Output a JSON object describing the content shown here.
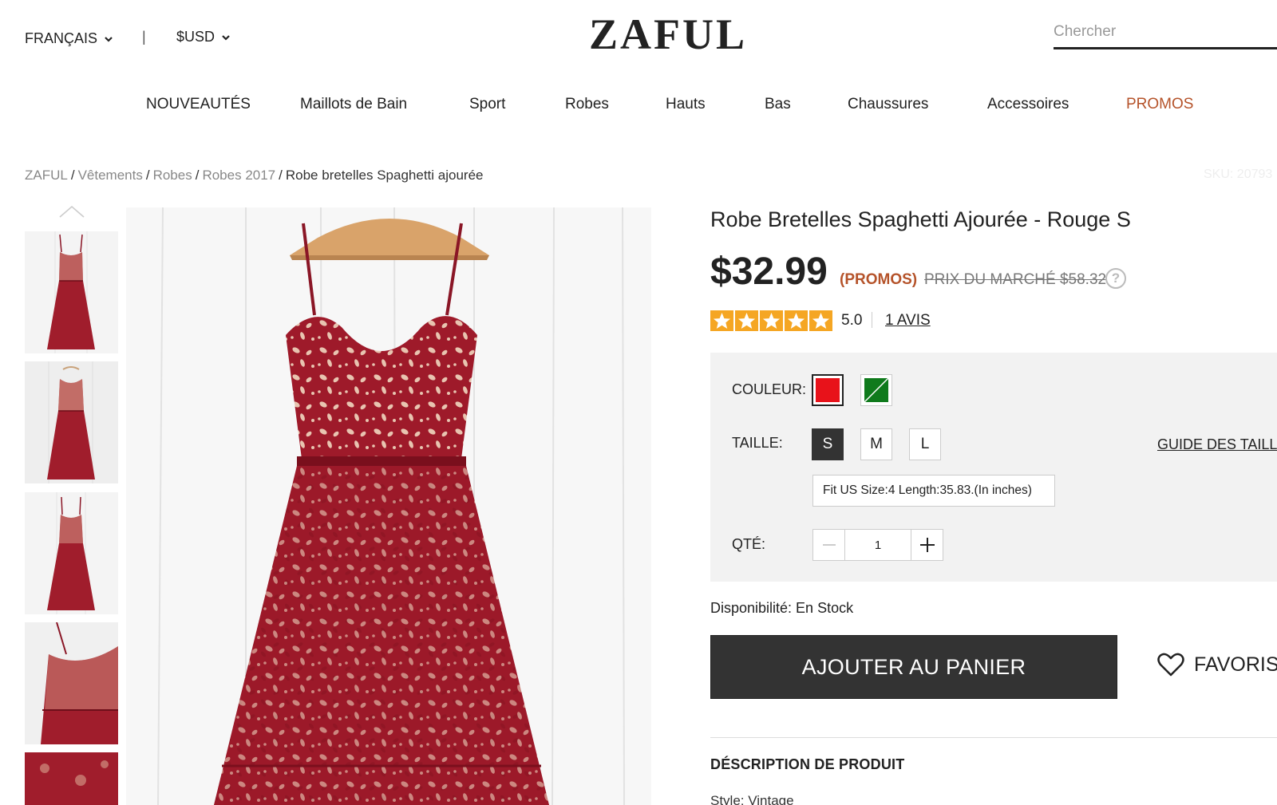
{
  "header": {
    "language": "FRANÇAIS",
    "separator": "|",
    "currency": "$USD",
    "logo": "ZAFUL",
    "search_placeholder": "Chercher"
  },
  "nav": {
    "items": [
      "NOUVEAUTÉS",
      "Maillots de Bain",
      "Sport",
      "Robes",
      "Hauts",
      "Bas",
      "Chaussures",
      "Accessoires",
      "PROMOS"
    ],
    "promo_color": "#b5532a"
  },
  "breadcrumb": {
    "items": [
      "ZAFUL",
      "Vêtements",
      "Robes",
      "Robes 2017"
    ],
    "current": "Robe bretelles Spaghetti ajourée",
    "separator": "/",
    "sku": "SKU: 20793"
  },
  "product": {
    "title": "Robe Bretelles Spaghetti Ajourée - Rouge S",
    "price": "$32.99",
    "promo_label": "(PROMOS)",
    "market_price": "PRIX DU MARCHÉ $58.32",
    "help_icon": "?",
    "rating": "5.0",
    "stars": 5,
    "reviews": "1 AVIS",
    "color_label": "COULEUR:",
    "colors": [
      {
        "name": "red",
        "hex": "#e8121a",
        "selected": true
      },
      {
        "name": "green",
        "hex": "#0f7a1c",
        "selected": false
      }
    ],
    "size_label": "TAILLE:",
    "sizes": [
      "S",
      "M",
      "L"
    ],
    "selected_size": "S",
    "size_guide": "GUIDE DES TAILLES",
    "fit_info": "Fit US Size:4    Length:35.83.(In inches)",
    "qty_label": "QTÉ:",
    "qty_value": "1",
    "availability": "Disponibilité: En Stock",
    "add_to_cart": "AJOUTER AU PANIER",
    "favorites": "FAVORIS",
    "description_heading": "DÉSCRIPTION DE PRODUIT",
    "style_line": "Style: Vintage"
  },
  "colors": {
    "dress": "#9e1a2a",
    "dress_dark": "#7a0f1d",
    "lining": "#e8c4b0",
    "accent": "#b5532a",
    "button_bg": "#333333"
  }
}
